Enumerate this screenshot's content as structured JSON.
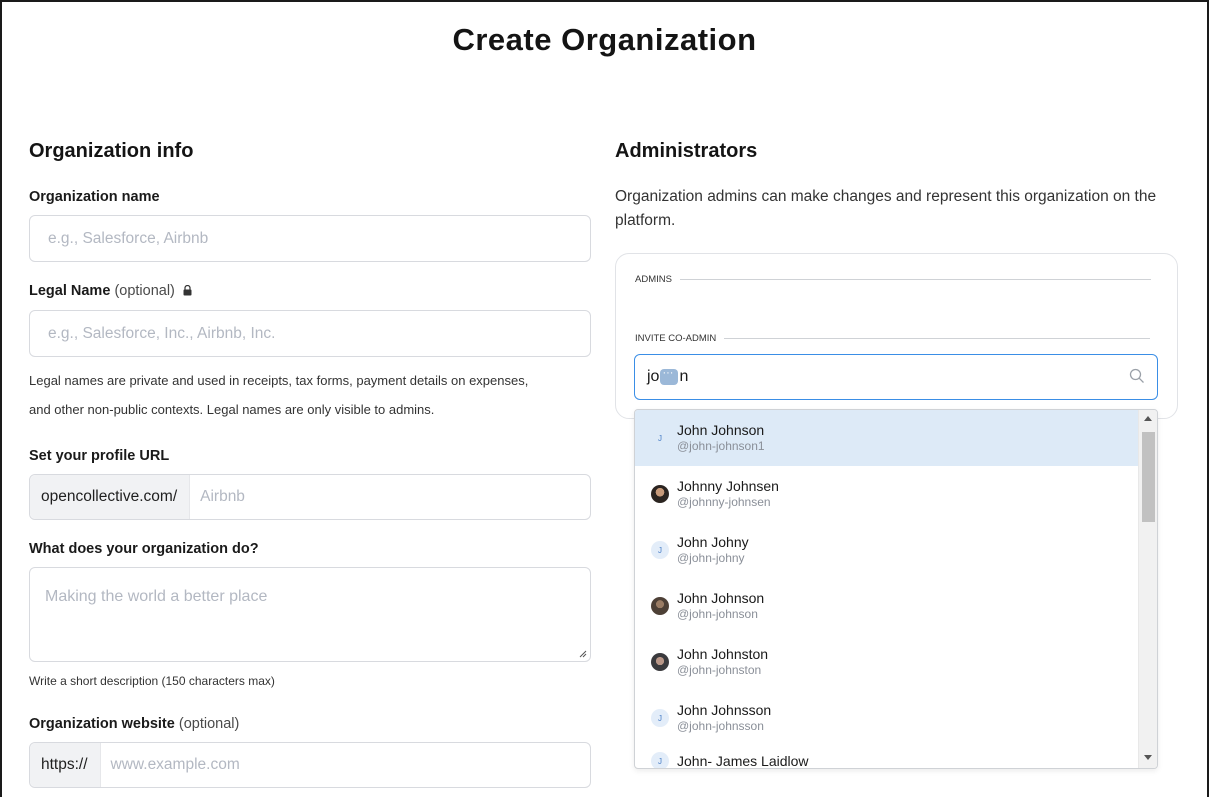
{
  "page": {
    "title": "Create Organization"
  },
  "org_info": {
    "section_title": "Organization info",
    "name_label": "Organization name",
    "name_placeholder": "e.g., Salesforce, Airbnb",
    "legal_label": "Legal Name",
    "legal_optional": "(optional)",
    "legal_placeholder": "e.g., Salesforce, Inc., Airbnb, Inc.",
    "legal_help_1": "Legal names are private and used in receipts, tax forms, payment details on expenses,",
    "legal_help_2": "and other non-public contexts. Legal names are only visible to admins.",
    "url_label": "Set your profile URL",
    "url_prefix": "opencollective.com/",
    "url_placeholder": "Airbnb",
    "desc_label": "What does your organization do?",
    "desc_placeholder": "Making the world a better place",
    "desc_help": "Write a short description (150 characters max)",
    "website_label": "Organization website",
    "website_optional": "(optional)",
    "website_prefix": "https://",
    "website_placeholder": "www.example.com"
  },
  "administrators": {
    "section_title": "Administrators",
    "description": "Organization admins can make changes and represent this organization on the platform.",
    "admins_label": "ADMINS",
    "invite_label": "INVITE CO-ADMIN",
    "search_value_start": "jo",
    "search_value_end": "n",
    "search_icon": "search-icon",
    "results": [
      {
        "name": "John Johnson",
        "handle": "@john-johnson1",
        "avatar": "J",
        "avatar_style": "plain",
        "highlighted": true
      },
      {
        "name": "Johnny Johnsen",
        "handle": "@johnny-johnsen",
        "avatar": "",
        "avatar_style": "photo1",
        "highlighted": false
      },
      {
        "name": "John Johny",
        "handle": "@john-johny",
        "avatar": "J",
        "avatar_style": "initial",
        "highlighted": false
      },
      {
        "name": "John Johnson",
        "handle": "@john-johnson",
        "avatar": "",
        "avatar_style": "photo2",
        "highlighted": false
      },
      {
        "name": "John Johnston",
        "handle": "@john-johnston",
        "avatar": "",
        "avatar_style": "photo3",
        "highlighted": false
      },
      {
        "name": "John Johnsson",
        "handle": "@john-johnsson",
        "avatar": "J",
        "avatar_style": "initial",
        "highlighted": false
      },
      {
        "name": "John- James Laidlow",
        "handle": "",
        "avatar": "J",
        "avatar_style": "initial",
        "highlighted": false
      }
    ]
  },
  "colors": {
    "focus_border": "#3a8ee6",
    "highlight_row": "#ddeaf7",
    "placeholder": "#b3b8c2"
  }
}
